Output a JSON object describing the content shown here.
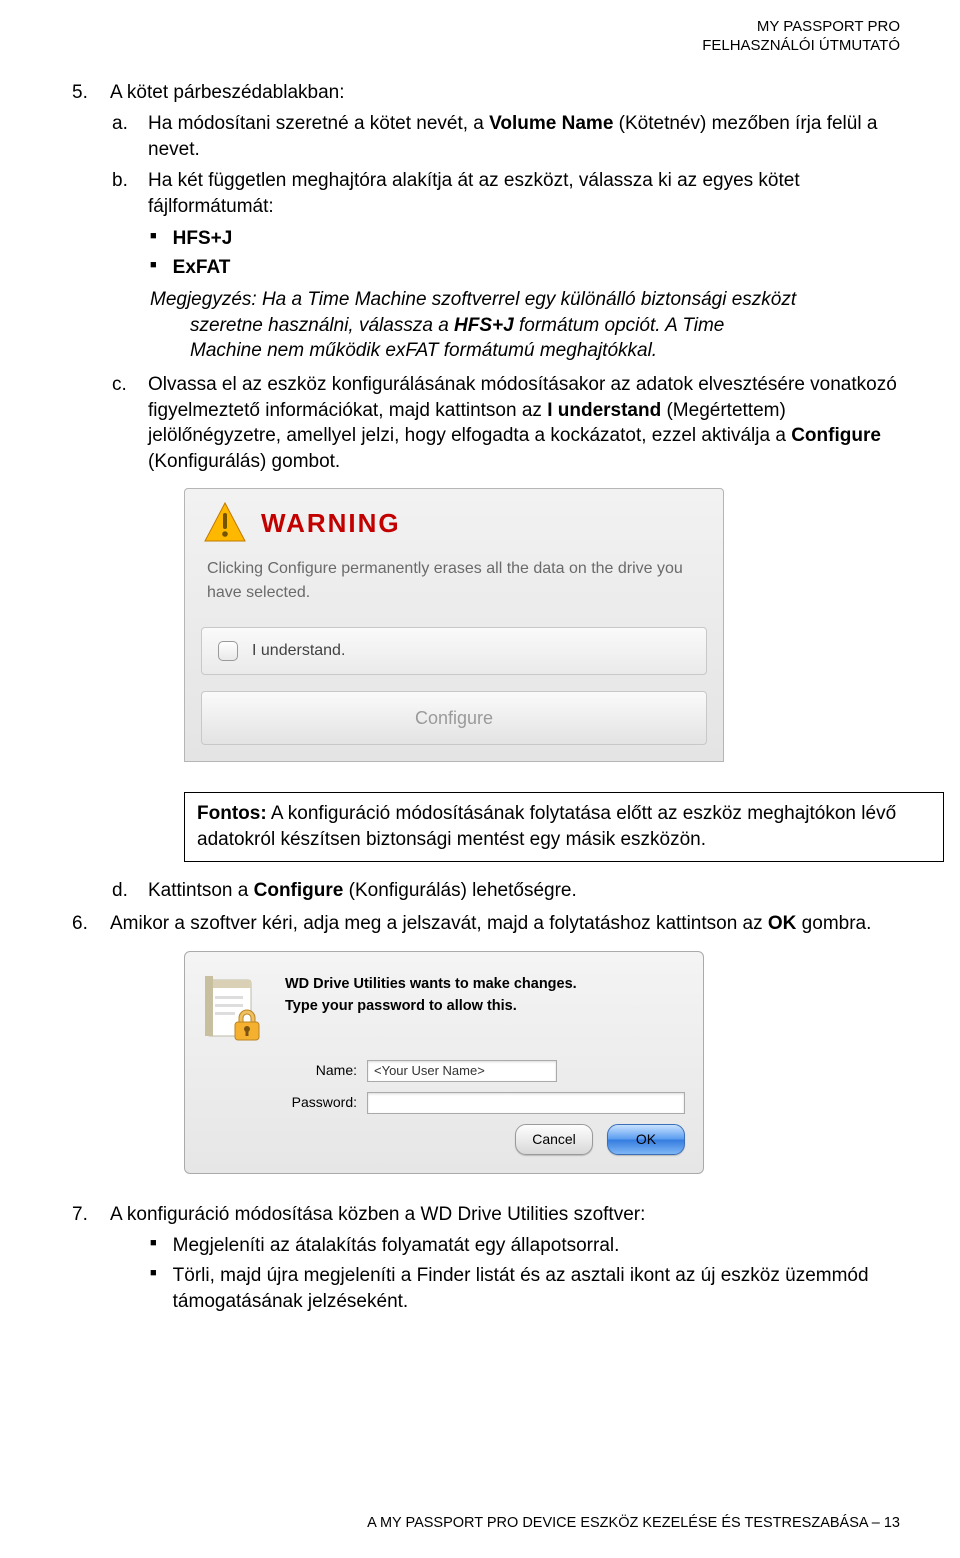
{
  "header": {
    "line1": "MY PASSPORT PRO",
    "line2": "FELHASZNÁLÓI ÚTMUTATÓ"
  },
  "step5": {
    "num": "5.",
    "intro": "A kötet párbeszédablakban:",
    "a": {
      "num": "a.",
      "before": "Ha módosítani szeretné a kötet nevét, a ",
      "bold": "Volume Name",
      "after": " (Kötetnév) mezőben írja felül a nevet."
    },
    "b": {
      "num": "b.",
      "text": "Ha két független meghajtóra alakítja át az eszközt, válassza ki az egyes kötet fájlformátumát:",
      "bul1": "HFS+J",
      "bul2": "ExFAT",
      "note_label": "Megjegyzés:",
      "note_l1": "Ha a Time Machine szoftverrel egy különálló biztonsági eszközt",
      "note_l2_pre": "szeretne használni, válassza a ",
      "note_l2_bold": "HFS+J",
      "note_l2_post": " formátum opciót. A Time",
      "note_l3": "Machine nem működik exFAT formátumú meghajtókkal."
    },
    "c": {
      "num": "c.",
      "l1_pre": "Olvassa el az eszköz konfigurálásának módosításakor az adatok elvesztésére vonatkozó figyelmeztető információkat, majd kattintson az ",
      "l1_bold": "I understand",
      "l2_pre": "(Megértettem) jelölőnégyzetre, amellyel jelzi, hogy elfogadta a kockázatot, ezzel aktiválja a ",
      "l2_bold": "Configure",
      "l2_post": " (Konfigurálás) gombot."
    },
    "d": {
      "num": "d.",
      "pre": "Kattintson a ",
      "bold": "Configure",
      "post": " (Konfigurálás) lehetőségre."
    }
  },
  "warning": {
    "title": "WARNING",
    "body": "Clicking Configure permanently erases all the data on the drive you have selected.",
    "understand": "I understand.",
    "configure": "Configure"
  },
  "fontos": {
    "bold": "Fontos:",
    "text": " A konfiguráció módosításának folytatása előtt az eszköz meghajtókon lévő adatokról készítsen biztonsági mentést egy másik eszközön."
  },
  "step6": {
    "num": "6.",
    "pre": "Amikor a szoftver kéri, adja meg a jelszavát, majd a folytatáshoz kattintson az ",
    "bold": "OK",
    "post": " gombra."
  },
  "auth": {
    "msg1": "WD Drive Utilities wants to make changes.",
    "msg2": "Type your password to allow this.",
    "name_label": "Name:",
    "name_value": "<Your User Name>",
    "pass_label": "Password:",
    "cancel": "Cancel",
    "ok": "OK"
  },
  "step7": {
    "num": "7.",
    "intro": "A konfiguráció módosítása közben a WD Drive Utilities szoftver:",
    "bul1": "Megjeleníti az átalakítás folyamatát egy állapotsorral.",
    "bul2": "Törli, majd újra megjeleníti a Finder listát és az asztali ikont az új eszköz üzemmód támogatásának jelzéseként."
  },
  "footer": "A MY PASSPORT PRO DEVICE ESZKÖZ KEZELÉSE ÉS TESTRESZABÁSA – 13"
}
